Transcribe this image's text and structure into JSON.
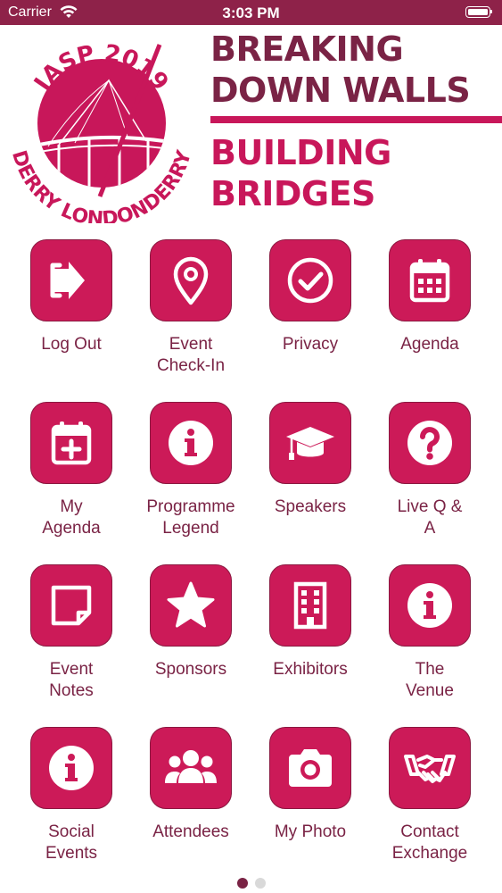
{
  "status": {
    "carrier": "Carrier",
    "time": "3:03 PM",
    "battery_level": 1.0
  },
  "banner": {
    "logo": {
      "top_text": "IASP 2019",
      "bottom_text": "DERRY LONDONDERRY"
    },
    "tagline": [
      "BREAKING",
      "DOWN WALLS",
      "BUILDING",
      "BRIDGES"
    ],
    "colors": {
      "dark": "#7a2345",
      "accent": "#c8175a"
    }
  },
  "menu": [
    {
      "label": "Log Out",
      "icon": "logout-icon"
    },
    {
      "label": "Event\nCheck-In",
      "icon": "map-pin-icon"
    },
    {
      "label": "Privacy",
      "icon": "check-circle-icon"
    },
    {
      "label": "Agenda",
      "icon": "calendar-icon"
    },
    {
      "label": "My\nAgenda",
      "icon": "calendar-plus-icon"
    },
    {
      "label": "Programme\nLegend",
      "icon": "info-circle-icon"
    },
    {
      "label": "Speakers",
      "icon": "graduation-cap-icon"
    },
    {
      "label": "Live Q &\nA",
      "icon": "question-circle-icon"
    },
    {
      "label": "Event\nNotes",
      "icon": "sticky-note-icon"
    },
    {
      "label": "Sponsors",
      "icon": "star-icon"
    },
    {
      "label": "Exhibitors",
      "icon": "building-icon"
    },
    {
      "label": "The\nVenue",
      "icon": "info-circle-icon"
    },
    {
      "label": "Social\nEvents",
      "icon": "info-circle-icon"
    },
    {
      "label": "Attendees",
      "icon": "users-icon"
    },
    {
      "label": "My Photo",
      "icon": "camera-icon"
    },
    {
      "label": "Contact\nExchange",
      "icon": "handshake-icon"
    }
  ],
  "pager": {
    "pages": 2,
    "current": 1
  },
  "theme": {
    "tile_color": "#cc1a58",
    "label_color": "#7a2345",
    "status_bar_color": "#8e2249"
  }
}
